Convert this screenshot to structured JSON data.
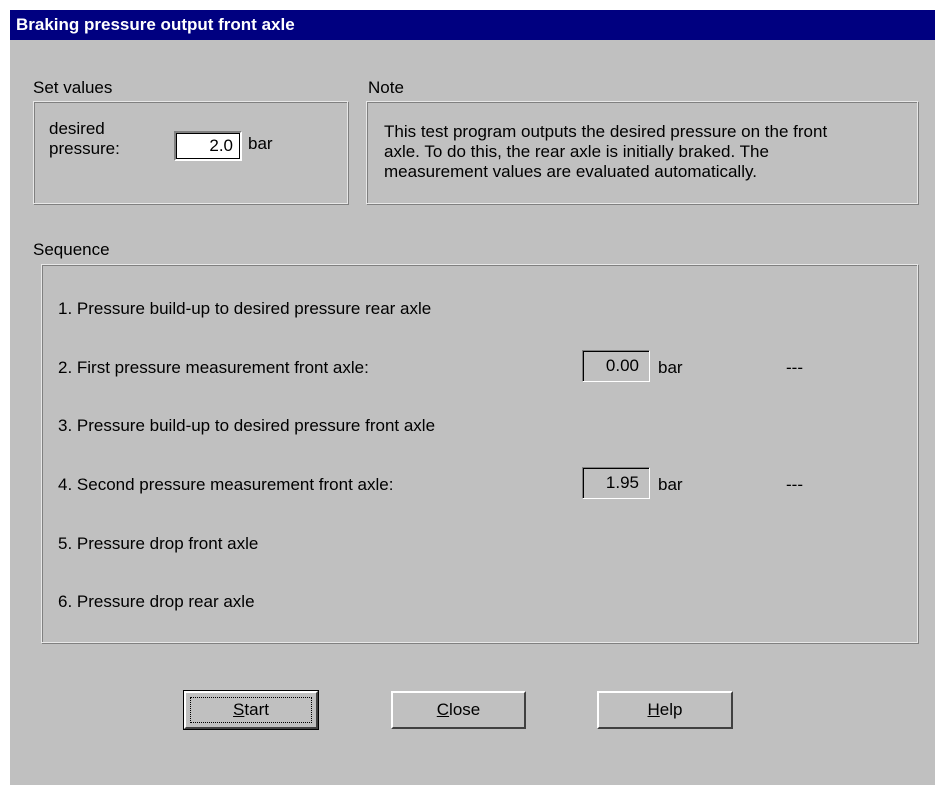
{
  "window": {
    "title": "Braking pressure output front axle"
  },
  "set_values": {
    "group_label": "Set values",
    "desired_label_line1": "desired",
    "desired_label_line2": "pressure:",
    "value": "2.0",
    "unit": "bar"
  },
  "note": {
    "group_label": "Note",
    "line1": "This test program outputs the desired pressure on the front",
    "line2": "axle. To do this, the rear axle is initially braked. The",
    "line3": "measurement values are evaluated automatically."
  },
  "sequence": {
    "group_label": "Sequence",
    "steps": [
      {
        "text": "1.  Pressure build-up to desired pressure rear axle"
      },
      {
        "text": "2.  First pressure measurement front axle:",
        "value": "0.00",
        "unit": "bar",
        "result": "---"
      },
      {
        "text": "3.  Pressure build-up to desired pressure front axle"
      },
      {
        "text": "4.  Second pressure measurement front axle:",
        "value": "1.95",
        "unit": "bar",
        "result": "---"
      },
      {
        "text": "5.  Pressure drop front axle"
      },
      {
        "text": "6.  Pressure drop rear axle"
      }
    ]
  },
  "buttons": {
    "start_key": "S",
    "start_rest": "tart",
    "close_key": "C",
    "close_rest": "lose",
    "help_key": "H",
    "help_rest": "elp"
  }
}
